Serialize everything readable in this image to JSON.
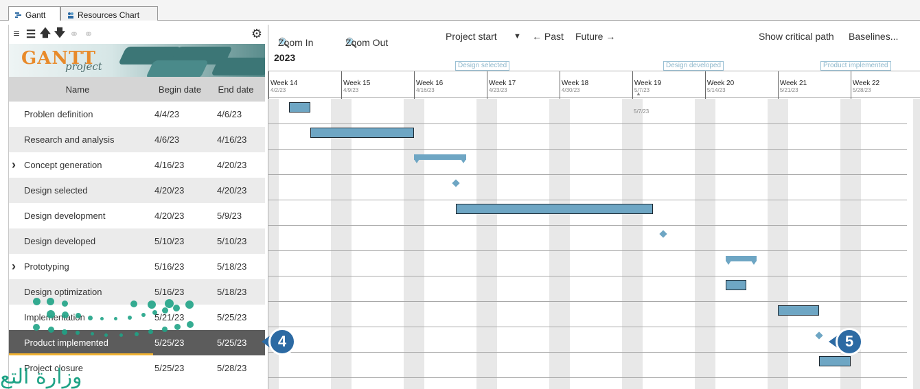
{
  "tabs": [
    {
      "label": "Gantt",
      "icon": "gantt-icon"
    },
    {
      "label": "Resources Chart",
      "icon": "resources-icon"
    }
  ],
  "left_toolbar": {
    "icons": [
      "indent-icon",
      "outdent-icon",
      "move-up-icon",
      "move-down-icon",
      "link-icon",
      "unlink-icon"
    ],
    "settings_icon": "gear-icon"
  },
  "logo": {
    "brand": "GANTT",
    "sub": "project"
  },
  "columns": {
    "name": "Name",
    "begin": "Begin date",
    "end": "End date"
  },
  "tasks": [
    {
      "name": "Problen definition",
      "begin": "4/4/23",
      "end": "4/6/23",
      "expandable": false
    },
    {
      "name": "Research and analysis",
      "begin": "4/6/23",
      "end": "4/16/23",
      "expandable": false
    },
    {
      "name": "Concept generation",
      "begin": "4/16/23",
      "end": "4/20/23",
      "expandable": true
    },
    {
      "name": "Design selected",
      "begin": "4/20/23",
      "end": "4/20/23",
      "expandable": false
    },
    {
      "name": "Design development",
      "begin": "4/20/23",
      "end": "5/9/23",
      "expandable": false
    },
    {
      "name": "Design developed",
      "begin": "5/10/23",
      "end": "5/10/23",
      "expandable": false
    },
    {
      "name": "Prototyping",
      "begin": "5/16/23",
      "end": "5/18/23",
      "expandable": true
    },
    {
      "name": "Design optimization",
      "begin": "5/16/23",
      "end": "5/18/23",
      "expandable": false
    },
    {
      "name": "Implementation",
      "begin": "5/21/23",
      "end": "5/25/23",
      "expandable": false
    },
    {
      "name": "Product implemented",
      "begin": "5/25/23",
      "end": "5/25/23",
      "expandable": false,
      "selected": true
    },
    {
      "name": "Project closure",
      "begin": "5/25/23",
      "end": "5/28/23",
      "expandable": false
    }
  ],
  "right_toolbar": {
    "zoom_in": "Zoom In",
    "zoom_out": "Zoom Out",
    "project_start": "Project start",
    "past": "← Past",
    "future": "Future →",
    "critical_path": "Show critical path",
    "baselines": "Baselines..."
  },
  "year": "2023",
  "milestone_labels": [
    "Design selected",
    "Design developed",
    "Product implemented"
  ],
  "weeks": [
    {
      "label": "Week 14",
      "date": "4/2/23"
    },
    {
      "label": "Week 15",
      "date": "4/9/23"
    },
    {
      "label": "Week 16",
      "date": "4/16/23"
    },
    {
      "label": "Week 17",
      "date": "4/23/23"
    },
    {
      "label": "Week 18",
      "date": "4/30/23"
    },
    {
      "label": "Week 19",
      "date": "5/7/23"
    },
    {
      "label": "Week 20",
      "date": "5/14/23"
    },
    {
      "label": "Week 21",
      "date": "5/21/23"
    },
    {
      "label": "Week 22",
      "date": "5/28/23"
    }
  ],
  "today_marker": "5/7/23",
  "callouts": [
    "4",
    "5"
  ],
  "watermark": "وزارة التع",
  "colors": {
    "bar": "#6ea6c4",
    "selected_row": "#5c5c5c",
    "callout": "#2c6aa3",
    "watermark": "#1fa386",
    "logo_orange": "#e88a2a"
  }
}
